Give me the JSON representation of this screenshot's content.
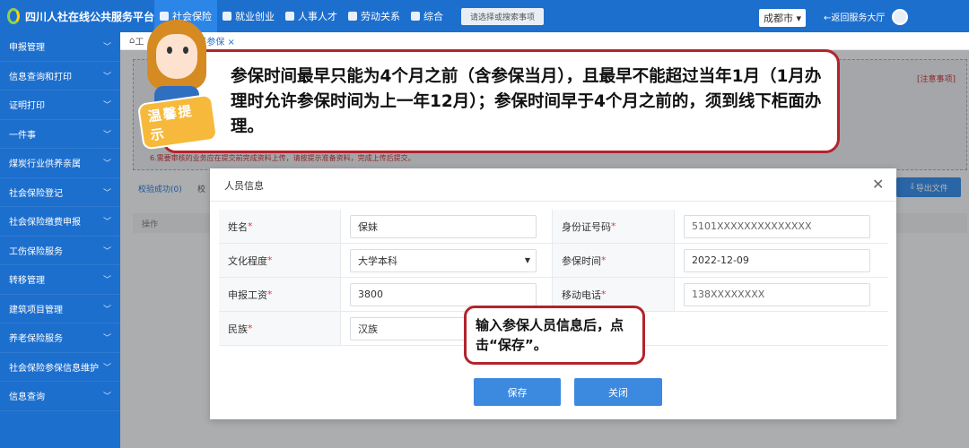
{
  "header": {
    "app_title": "四川人社在线公共服务平台",
    "nav": [
      "社会保险",
      "就业创业",
      "人事人才",
      "劳动关系",
      "综合"
    ],
    "search_placeholder": "请选择或搜索事项",
    "city": "成都市",
    "back_label": "←返回服务大厅"
  },
  "sidebar": {
    "items": [
      "申报管理",
      "信息查询和打印",
      "证明打印",
      "一件事",
      "煤炭行业供养亲属",
      "社会保险登记",
      "社会保险缴费申报",
      "工伤保险服务",
      "转移管理",
      "建筑项目管理",
      "养老保险服务",
      "社会保险参保信息维护",
      "信息查询"
    ]
  },
  "breadcrumb": {
    "home": "工",
    "tab": "民参保"
  },
  "background": {
    "notice_link": "[注意事项]",
    "notice_red": "6.需要审核的业务应在提交前完成资料上传，请按提示准备资料，完成上传后提交。",
    "tab_success": "校验成功(0)",
    "tab_other": "校",
    "export_label": "导出文件",
    "op_label": "操作"
  },
  "modal": {
    "title": "人员信息",
    "fields": {
      "name_label": "姓名",
      "name_value": "保妹",
      "id_label": "身份证号码",
      "id_value": "5101XXXXXXXXXXXXXX",
      "edu_label": "文化程度",
      "edu_value": "大学本科",
      "date_label": "参保时间",
      "date_value": "2022-12-09",
      "wage_label": "申报工资",
      "wage_value": "3800",
      "phone_label": "移动电话",
      "phone_value": "138XXXXXXXX",
      "ethnic_label": "民族",
      "ethnic_value": "汉族"
    },
    "save_label": "保存",
    "close_label": "关闭"
  },
  "overlay": {
    "tip": "参保时间最早只能为4个月之前（含参保当月），且最早不能超过当年1月（1月办理时允许参保时间为上一年12月）；参保时间早于4个月之前的，须到线下柜面办理。",
    "hint": "输入参保人员信息后，点击“保存”。",
    "sticker": "温馨提示"
  },
  "colors": {
    "brand": "#1d6fce",
    "button": "#3c8ae0",
    "accent_red": "#b2242c"
  }
}
